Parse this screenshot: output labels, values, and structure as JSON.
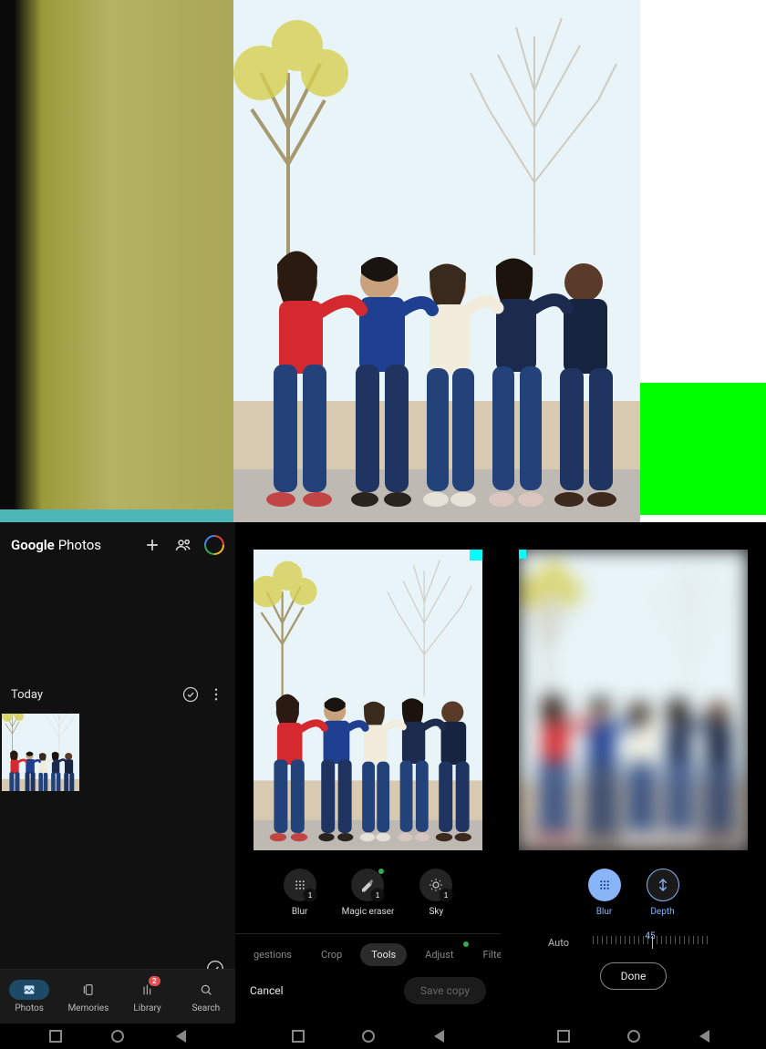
{
  "gp": {
    "brand_a": "Google",
    "brand_b": "Photos",
    "section_label": "Today",
    "nav": {
      "photos": "Photos",
      "memories": "Memories",
      "library": "Library",
      "search": "Search",
      "library_badge": "2"
    }
  },
  "editorB": {
    "tools": {
      "blur": "Blur",
      "magic_eraser": "Magic eraser",
      "sky": "Sky"
    },
    "cats": {
      "suggestions": "gestions",
      "crop": "Crop",
      "tools": "Tools",
      "adjust": "Adjust",
      "filters": "Filters"
    },
    "cancel": "Cancel",
    "save": "Save copy"
  },
  "editorC": {
    "tools": {
      "blur": "Blur",
      "depth": "Depth"
    },
    "auto": "Auto",
    "value": "45",
    "done": "Done"
  }
}
